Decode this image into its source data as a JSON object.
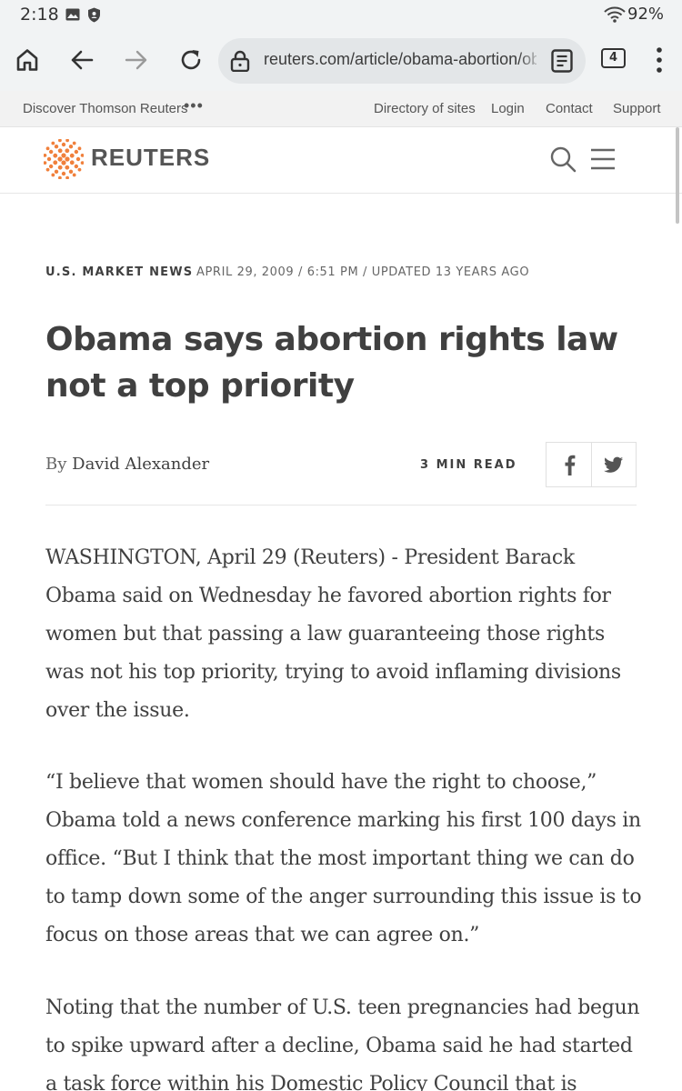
{
  "status_bar": {
    "time": "2:18",
    "battery": "92%"
  },
  "browser": {
    "url": "reuters.com/article/obama-abortion/obama-says-abortion-rights-law",
    "tab_count": "4"
  },
  "top_strip": {
    "discover": "Discover Thomson Reuters",
    "more": "•••",
    "links": [
      "Directory of sites",
      "Login",
      "Contact",
      "Support"
    ]
  },
  "header": {
    "logo_text": "REUTERS"
  },
  "article": {
    "section": "U.S. MARKET NEWS",
    "dateline": "APRIL 29, 2009 / 6:51 PM / UPDATED 13 YEARS AGO",
    "headline": "Obama says abortion rights law not a top priority",
    "byline_prefix": "By",
    "author": "David Alexander",
    "read_time": "3 MIN READ",
    "paragraphs": [
      "WASHINGTON, April 29 (Reuters) - President Barack Obama said on Wednesday he favored abortion rights for women but that passing a law guaranteeing those rights was not his top priority, trying to avoid inflaming divisions over the issue.",
      "“I believe that women should have the right to choose,” Obama told a news conference marking his first 100 days in office. “But I think that the most important thing we can do to tamp down some of the anger surrounding this issue is to focus on those areas that we can agree on.”",
      "Noting that the number of U.S. teen pregnancies had begun to spike upward after a decline, Obama said he had started a task force within his Domestic Policy Council that is"
    ]
  },
  "colors": {
    "chrome_bg": "#f1f3f4",
    "url_bg": "#e3e6e8",
    "reuters_orange": "#f0803c",
    "text": "#404040"
  },
  "icons": [
    "image-icon",
    "shield-icon",
    "wifi-icon",
    "home-icon",
    "back-arrow-icon",
    "forward-arrow-icon",
    "reload-icon",
    "lock-icon",
    "reader-mode-icon",
    "tabs-icon",
    "more-vert-icon",
    "reuters-logo-icon",
    "search-icon",
    "hamburger-menu-icon",
    "facebook-icon",
    "twitter-icon"
  ]
}
